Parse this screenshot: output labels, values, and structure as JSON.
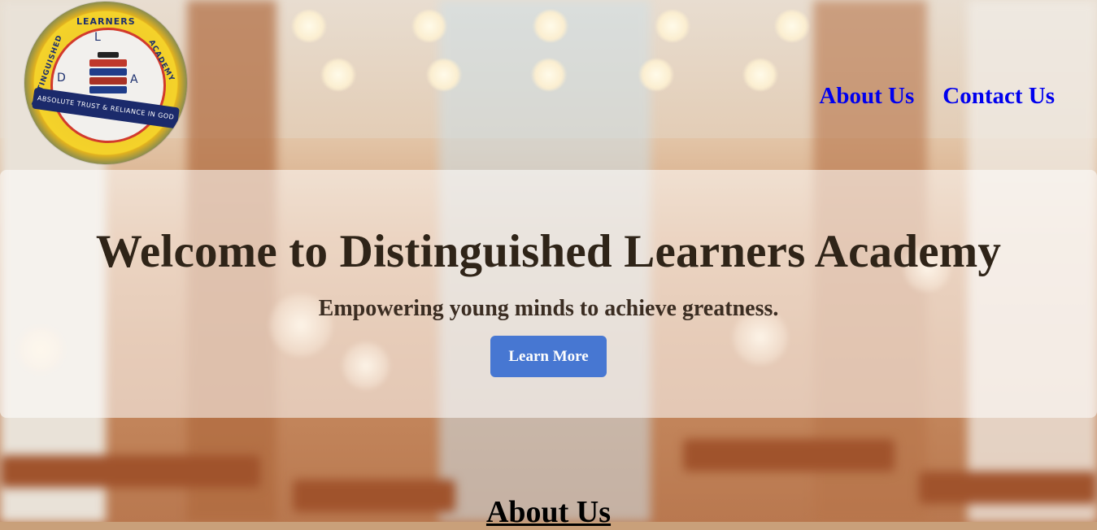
{
  "logo": {
    "ring_top": "LEARNERS",
    "ring_left": "DISTINGUISHED",
    "ring_right": "ACADEMY",
    "banner": "ABSOLUTE TRUST & RELIANCE IN GOD",
    "letter_l": "L",
    "letter_d": "D",
    "letter_a": "A"
  },
  "nav": {
    "items": [
      {
        "label": "About Us"
      },
      {
        "label": "Contact Us"
      }
    ]
  },
  "hero": {
    "title": "Welcome to Distinguished Learners Academy",
    "subtitle": "Empowering young minds to achieve greatness.",
    "button_label": "Learn More",
    "button_color": "#3f72d2"
  },
  "sections": {
    "about_title": "About Us"
  },
  "colors": {
    "link": "#0000ee",
    "hero_overlay": "rgba(255,255,255,.55)"
  }
}
